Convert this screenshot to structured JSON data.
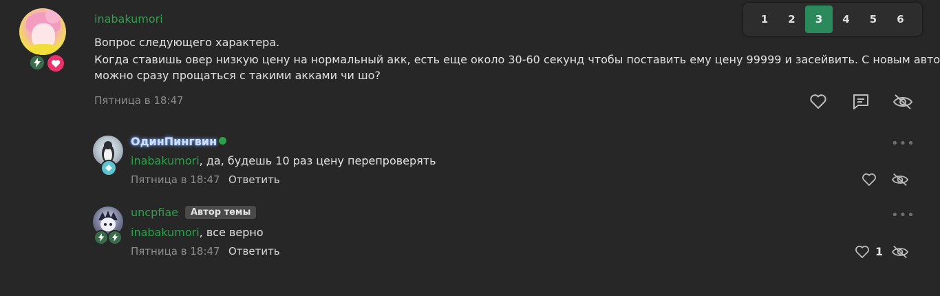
{
  "post": {
    "author": "inabakumori",
    "line1": "Вопрос следующего характера.",
    "line2": "Когда ставишь овер низкую цену на нормальный акк, есть еще около 30-60 секунд чтобы поставить ему цену 99999 и засейвить. С новым автобаеи",
    "line3": "можно сразу прощаться с такими акками чи шо?",
    "date": "Пятница в 18:47"
  },
  "pagination": {
    "pages": [
      "1",
      "2",
      "3",
      "4",
      "5",
      "6"
    ],
    "current": "3"
  },
  "comments": [
    {
      "author": "ОдинПингвин",
      "mention": "inabakumori",
      "text": ", да, будешь 10 раз цену перепроверять",
      "date": "Пятница в 18:47",
      "reply_label": "Ответить",
      "online": true
    },
    {
      "author": "uncpfiae",
      "tag": "Автор темы",
      "mention": "inabakumori",
      "text": ", все верно",
      "date": "Пятница в 18:47",
      "reply_label": "Ответить",
      "likes": "1"
    }
  ],
  "colors": {
    "background": "#272727",
    "username_green": "#2ea04b",
    "accent": "#2a8a5c",
    "online": "#2ea04b"
  },
  "icons": [
    "heart-icon",
    "comment-icon",
    "eye-off-icon",
    "more-icon",
    "bolt-icon",
    "heart-badge-icon",
    "diamond-icon"
  ]
}
